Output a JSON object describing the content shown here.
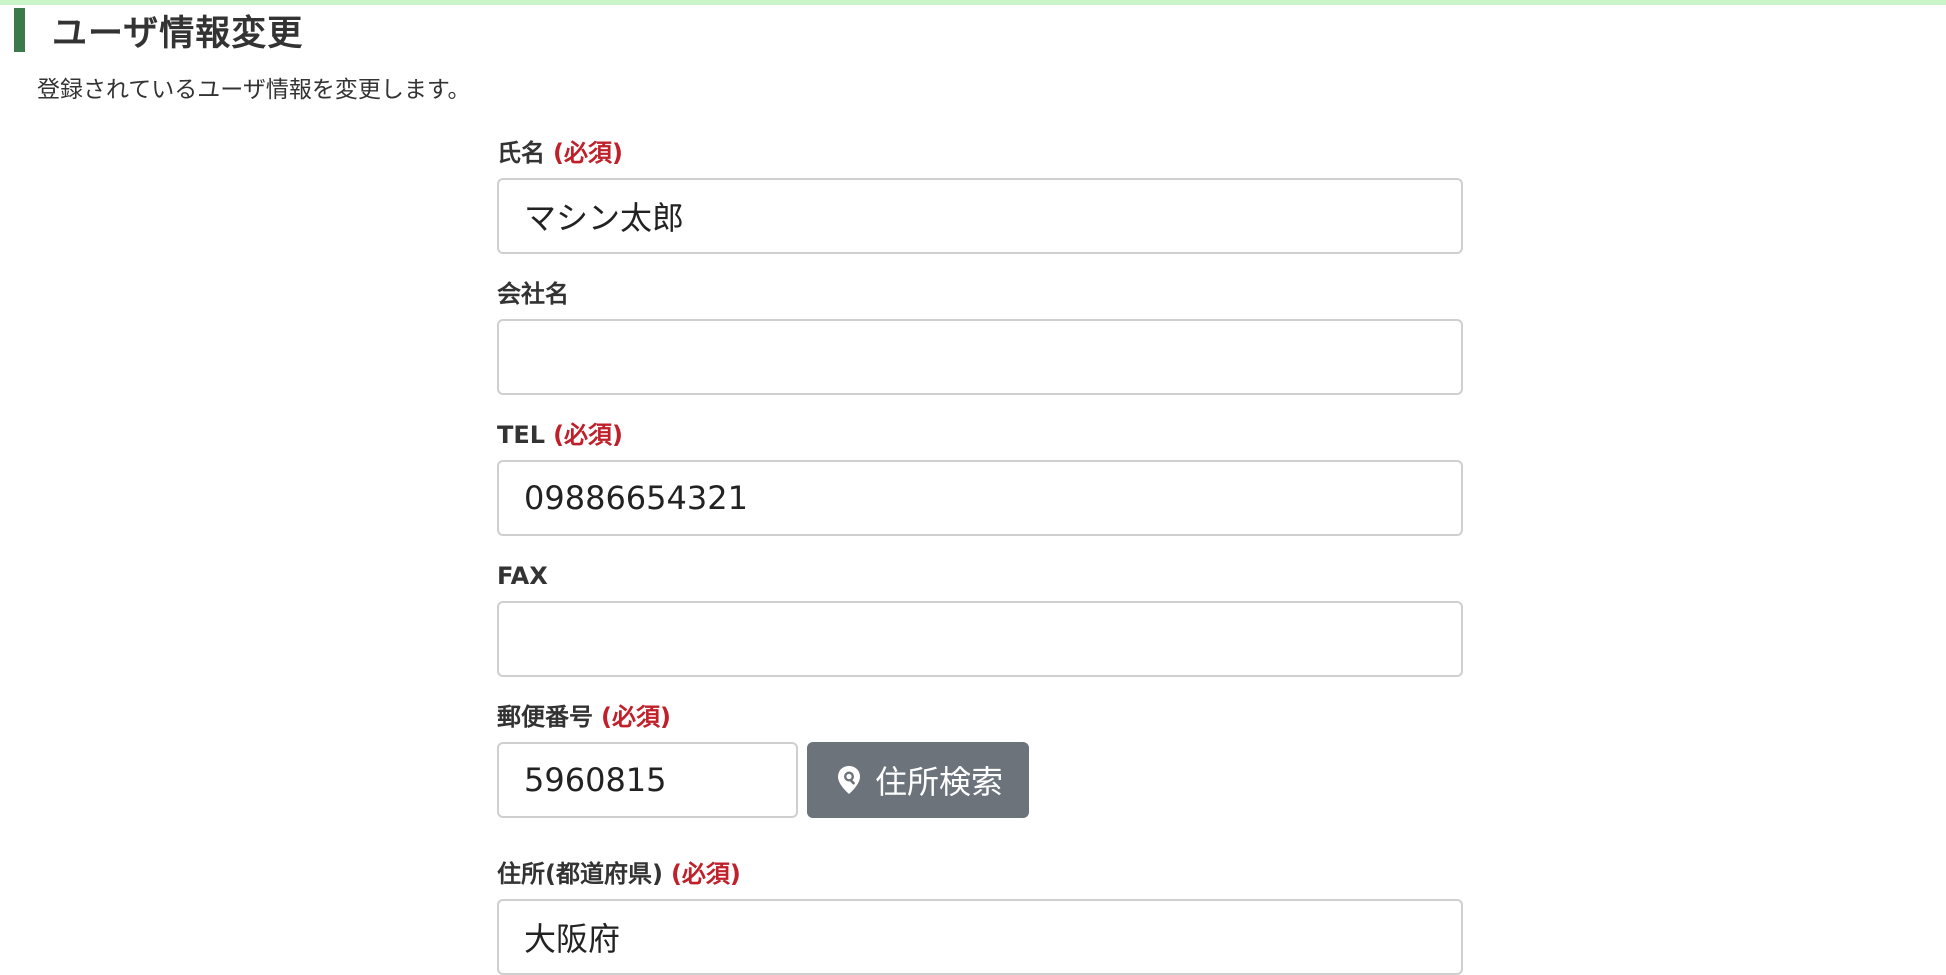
{
  "header": {
    "title": "ユーザ情報変更",
    "description": "登録されているユーザ情報を変更します。"
  },
  "colors": {
    "accent_bar": "#3c7a4b",
    "top_border": "#c9f5c9",
    "required": "#c0202a",
    "button_bg": "#6c737b"
  },
  "form": {
    "required_mark": "(必須)",
    "name": {
      "label": "氏名",
      "value": "マシン太郎"
    },
    "company": {
      "label": "会社名",
      "value": ""
    },
    "tel": {
      "label": "TEL",
      "value": "09886654321"
    },
    "fax": {
      "label": "FAX",
      "value": ""
    },
    "zip": {
      "label": "郵便番号",
      "value": "5960815",
      "search_button_label": "住所検索",
      "search_icon": "map-pin-search-icon"
    },
    "prefecture": {
      "label": "住所(都道府県)",
      "value": "大阪府"
    }
  }
}
